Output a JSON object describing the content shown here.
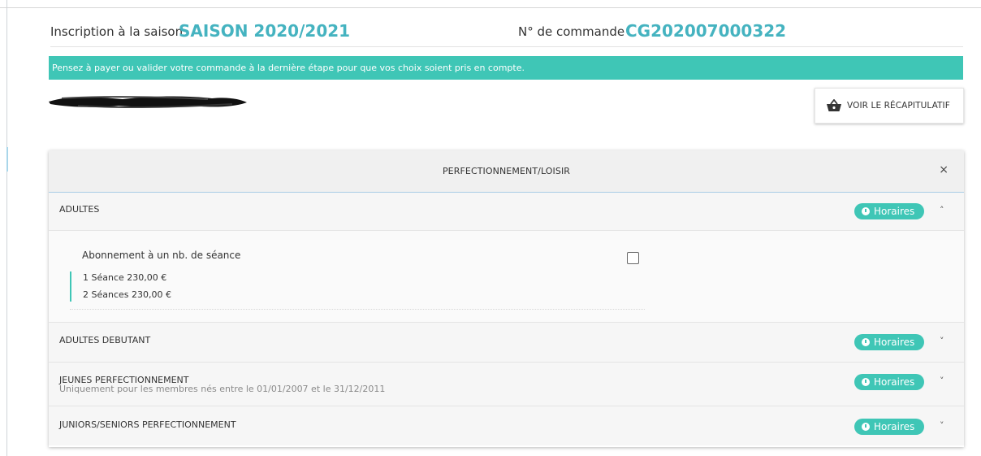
{
  "header": {
    "season_label": "Inscription à la saison",
    "season_value": "SAISON 2020/2021",
    "order_label": "N° de commande",
    "order_value": "CG202007000322"
  },
  "banner": {
    "text": "Pensez à payer ou valider votre commande à la dernière étape pour que vos choix soient pris en compte."
  },
  "recap_button": {
    "label": "VOIR LE RÉCAPITULATIF",
    "icon": "basket-icon"
  },
  "panel": {
    "title": "PERFECTIONNEMENT/LOISIR",
    "close_label": "×",
    "sections": [
      {
        "title": "ADULTES",
        "subtitle": "",
        "badge": "Horaires",
        "chevron": "˄",
        "expanded": true,
        "option": {
          "title": "Abonnement à un nb. de séance",
          "prices": [
            "1 Séance 230,00 €",
            "2 Séances 230,00 €"
          ],
          "checked": false
        }
      },
      {
        "title": "ADULTES DEBUTANT",
        "subtitle": "",
        "badge": "Horaires",
        "chevron": "˅",
        "expanded": false
      },
      {
        "title": "JEUNES PERFECTIONNEMENT",
        "subtitle": "Uniquement pour les membres nés entre le 01/01/2007 et le 31/12/2011",
        "badge": "Horaires",
        "chevron": "˅",
        "expanded": false
      },
      {
        "title": "JUNIORS/SENIORS PERFECTIONNEMENT",
        "subtitle": "",
        "badge": "Horaires",
        "chevron": "˅",
        "expanded": false
      }
    ]
  },
  "colors": {
    "accent": "#45b3c0",
    "banner": "#3fc6b6",
    "badge": "#3fc6b6"
  }
}
